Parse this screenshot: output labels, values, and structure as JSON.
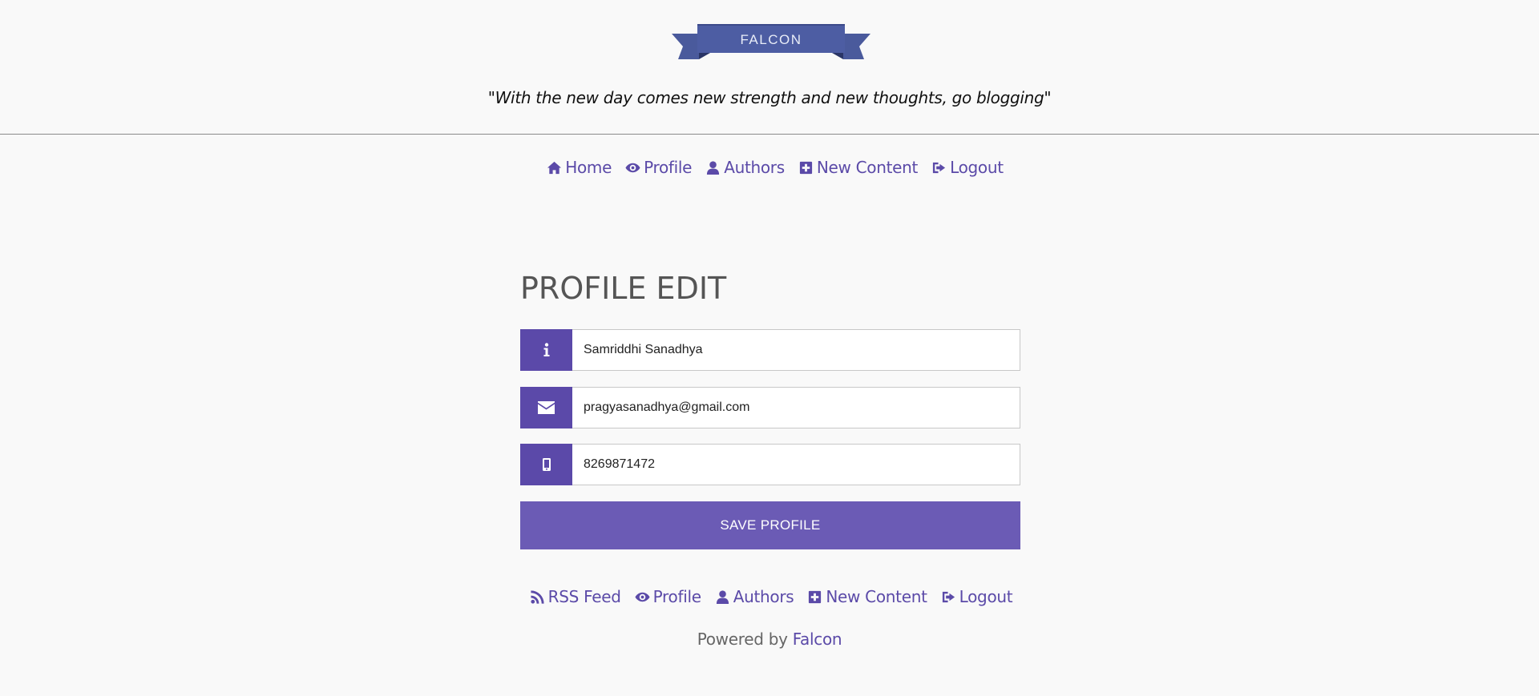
{
  "header": {
    "logo_text": "FALCON",
    "tagline": "\"With the new day comes new strength and new thoughts, go blogging\""
  },
  "top_nav": [
    {
      "label": "Home",
      "icon": "home-icon"
    },
    {
      "label": "Profile",
      "icon": "eye-icon"
    },
    {
      "label": "Authors",
      "icon": "user-icon"
    },
    {
      "label": "New Content",
      "icon": "plus-square-icon"
    },
    {
      "label": "Logout",
      "icon": "sign-out-icon"
    }
  ],
  "form": {
    "title": "PROFILE EDIT",
    "name_value": "Samriddhi Sanadhya",
    "email_value": "pragyasanadhya@gmail.com",
    "phone_value": "8269871472",
    "save_label": "SAVE PROFILE"
  },
  "bottom_nav": [
    {
      "label": "RSS Feed",
      "icon": "rss-icon"
    },
    {
      "label": "Profile",
      "icon": "eye-icon"
    },
    {
      "label": "Authors",
      "icon": "user-icon"
    },
    {
      "label": "New Content",
      "icon": "plus-square-icon"
    },
    {
      "label": "Logout",
      "icon": "sign-out-icon"
    }
  ],
  "footer": {
    "powered_prefix": "Powered by",
    "powered_link": "Falcon"
  },
  "colors": {
    "accent": "#5b4aa8",
    "button": "#6b5bb5",
    "banner": "#4a5a9c"
  }
}
